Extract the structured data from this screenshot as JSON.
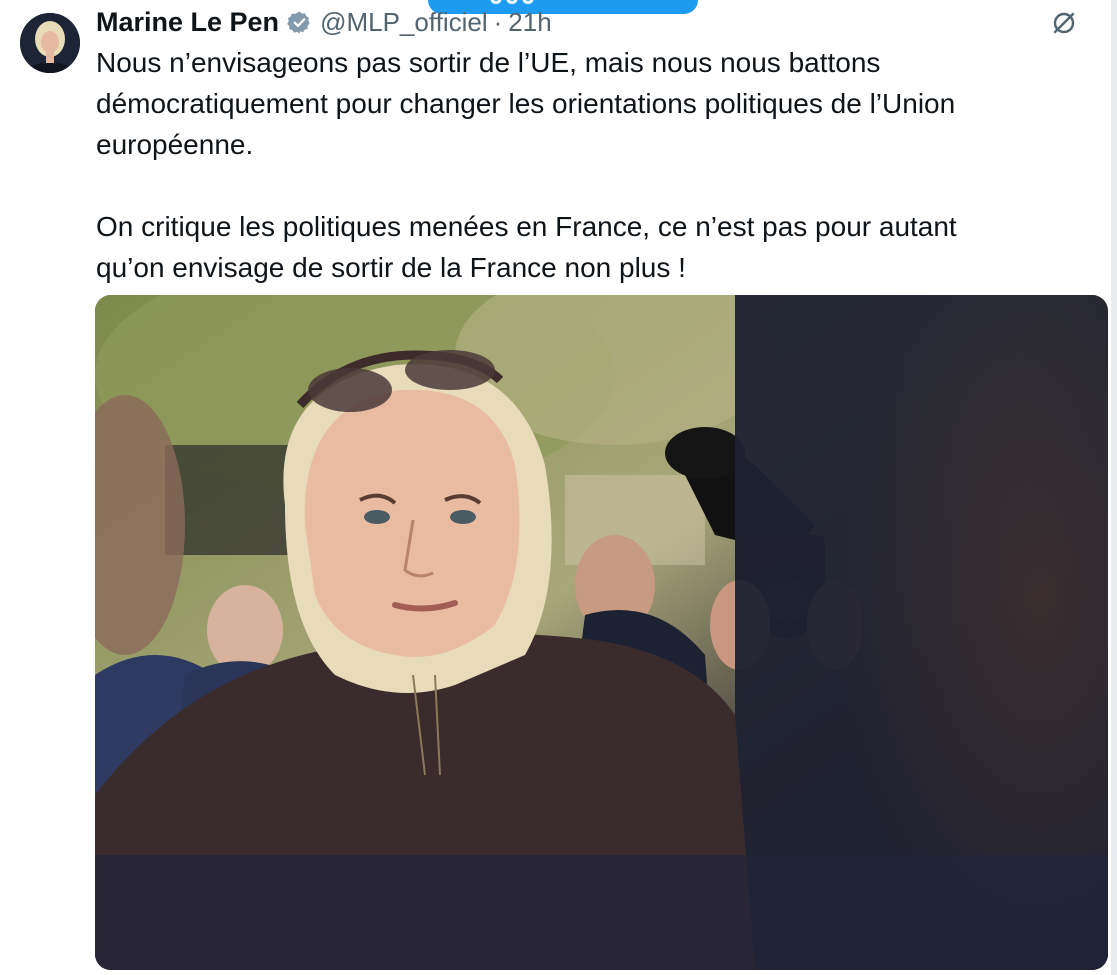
{
  "author": {
    "name": "Marine Le Pen",
    "handle": "@MLP_officiel",
    "separator": "·",
    "time": "21h",
    "verified": true
  },
  "tweet": {
    "text": "Nous n’envisageons pas sortir de l’UE, mais nous nous battons\ndémocratiquement pour changer les orientations politiques de l’Union\neuropéenne.\n\nOn critique les politiques menées en France, ce n’est pas pour autant\nqu’on envisage de sortir de la France non plus !"
  },
  "icons": {
    "verified": "verified-badge-icon",
    "more": "grok-slash-icon",
    "pill": "new-posts-pill"
  },
  "colors": {
    "accent": "#1d9bf0",
    "text": "#0f1419",
    "secondary": "#536471",
    "verified_badge": "#829aab"
  }
}
